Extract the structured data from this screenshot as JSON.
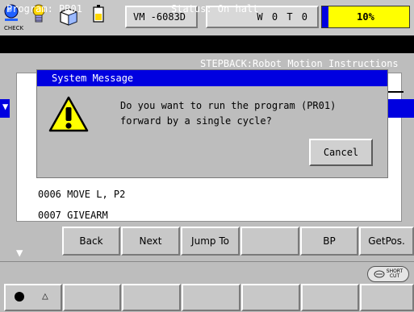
{
  "topbar": {
    "check_label": "CHECK",
    "icons": [
      "check-icon",
      "lightbulb-icon",
      "cube-icon",
      "battery-icon"
    ],
    "machine": "VM  -6083D",
    "mode": "W 0 T 0",
    "speed_value": "10%",
    "speed_fraction": 0.07,
    "speed_bar_color": "#0000e0",
    "speed_bg_color": "#ffff00"
  },
  "program": {
    "program_label": "Program: PR01",
    "status_label": "Status: On halt"
  },
  "editor": {
    "heading": "STEPBACK:Robot Motion Instructions",
    "lines": [
      "0006 MOVE L, P2",
      "0007 GIVEARM"
    ],
    "cursor_mark": "▼"
  },
  "dialog": {
    "title": "System Message",
    "message": "Do you want to run the program (PR01)\nforward by a single cycle?",
    "cancel_label": "Cancel",
    "title_color": "#0000e0"
  },
  "function_keys": {
    "page_icon": "▼",
    "keys": [
      "Back",
      "Next",
      "Jump To",
      "",
      "BP",
      "GetPos."
    ]
  },
  "bottom": {
    "shortcut_label": "SHORT\nCUT",
    "triangle": "△"
  }
}
